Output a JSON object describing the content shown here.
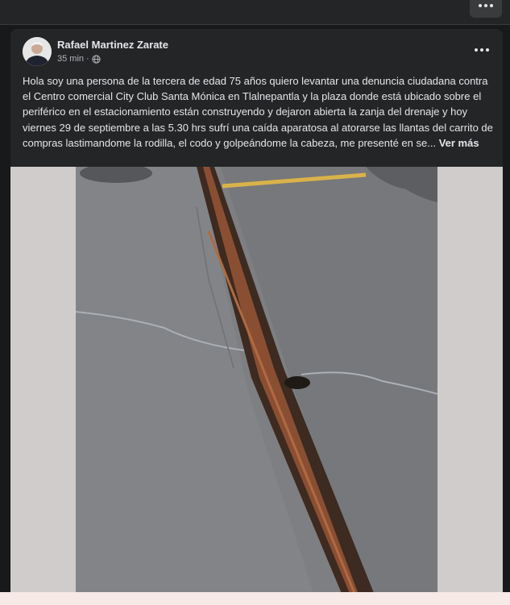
{
  "header": {
    "more_icon": "more-horizontal-icon"
  },
  "post": {
    "author": "Rafael Martinez Zarate",
    "time": "35 min",
    "separator": "·",
    "privacy_icon": "globe-icon",
    "more_icon": "more-horizontal-icon",
    "text": "Hola soy una persona de la tercera de edad 75 años quiero levantar una denuncia ciudadana contra el Centro comercial City Club Santa Mónica en Tlalnepantla y la plaza donde está ubicado sobre el periférico en el estacionamiento están construyendo y dejaron abierta la zanja del drenaje y hoy viernes 29 de septiembre a las 5.30 hrs sufrí una caída aparatosa al atorarse las llantas del carrito de compras lastimandome la rodilla, el codo y golpeándome la cabeza, me presenté en se...",
    "see_more": "Ver más"
  },
  "colors": {
    "page_bg": "#18191a",
    "card_bg": "#242526",
    "text_primary": "#e4e6eb",
    "text_secondary": "#b0b3b8"
  }
}
